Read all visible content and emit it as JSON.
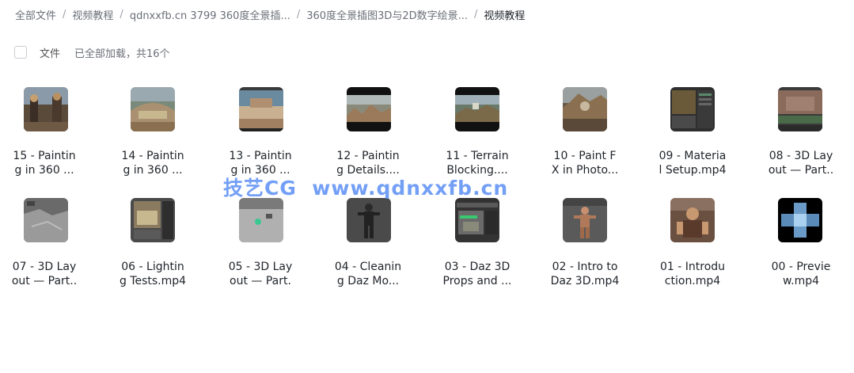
{
  "breadcrumb": {
    "items": [
      "全部文件",
      "视频教程",
      "qdnxxfb.cn 3799 360度全景插...",
      "360度全景插图3D与2D数字绘景...",
      "视频教程"
    ],
    "separator": "/"
  },
  "toolbar": {
    "column_label": "文件",
    "load_status": "已全部加载，共16个"
  },
  "files": [
    {
      "name": "15 - Paintin\ng in 360 ...",
      "thumb": "painting-360-warriors"
    },
    {
      "name": "14 - Paintin\ng in 360 ...",
      "thumb": "painting-360-arena"
    },
    {
      "name": "13 - Paintin\ng in 360 ...",
      "thumb": "painting-360-panorama"
    },
    {
      "name": "12 - Paintin\ng Details....",
      "thumb": "painting-details-ruins"
    },
    {
      "name": "11 - Terrain\nBlocking....",
      "thumb": "terrain-blocking"
    },
    {
      "name": "10 - Paint F\nX in Photo...",
      "thumb": "paint-fx-photoshop"
    },
    {
      "name": "09 - Materia\nl Setup.mp4",
      "thumb": "material-setup"
    },
    {
      "name": "08 - 3D Lay\nout — Part..",
      "thumb": "3d-layout-part"
    },
    {
      "name": "07 - 3D Lay\nout — Part..",
      "thumb": "3d-layout-gray"
    },
    {
      "name": "06 - Lightin\ng Tests.mp4",
      "thumb": "lighting-tests"
    },
    {
      "name": "05 - 3D Lay\nout — Part.",
      "thumb": "3d-layout-floor"
    },
    {
      "name": "04 - Cleanin\ng Daz Mo...",
      "thumb": "cleaning-daz-model"
    },
    {
      "name": "03 - Daz 3D\nProps and ...",
      "thumb": "daz-props"
    },
    {
      "name": "02 - Intro to\nDaz 3D.mp4",
      "thumb": "intro-daz"
    },
    {
      "name": "01 - Introdu\nction.mp4",
      "thumb": "introduction"
    },
    {
      "name": "00 - Previe\nw.mp4",
      "thumb": "preview-cube"
    }
  ],
  "watermark": "技艺CG  www.qdnxxfb.cn"
}
